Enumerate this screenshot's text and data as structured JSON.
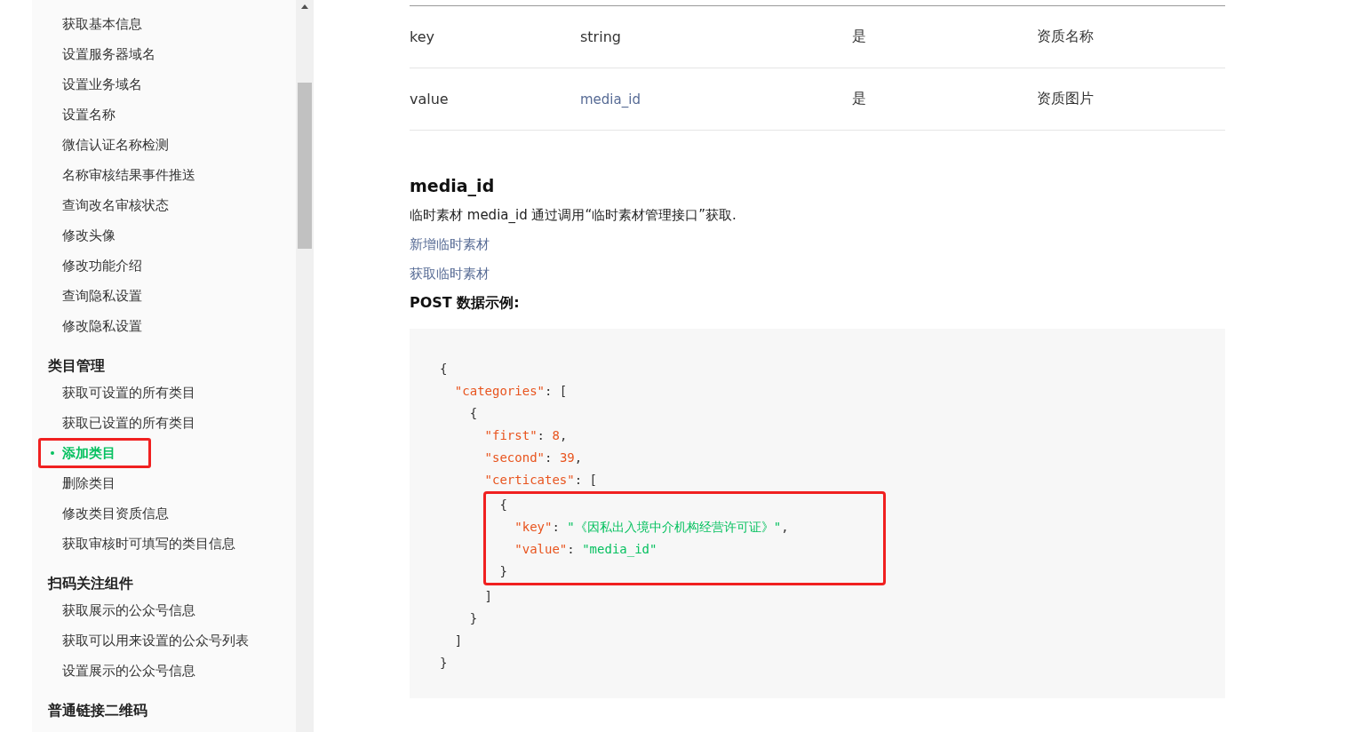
{
  "sidebar": {
    "groups": [
      {
        "items": [
          {
            "label": "获取基本信息",
            "selected": false,
            "highlighted": false
          },
          {
            "label": "设置服务器域名",
            "selected": false,
            "highlighted": false
          },
          {
            "label": "设置业务域名",
            "selected": false,
            "highlighted": false
          },
          {
            "label": "设置名称",
            "selected": false,
            "highlighted": false
          },
          {
            "label": "微信认证名称检测",
            "selected": false,
            "highlighted": false
          },
          {
            "label": "名称审核结果事件推送",
            "selected": false,
            "highlighted": false
          },
          {
            "label": "查询改名审核状态",
            "selected": false,
            "highlighted": false
          },
          {
            "label": "修改头像",
            "selected": false,
            "highlighted": false
          },
          {
            "label": "修改功能介绍",
            "selected": false,
            "highlighted": false
          },
          {
            "label": "查询隐私设置",
            "selected": false,
            "highlighted": false
          },
          {
            "label": "修改隐私设置",
            "selected": false,
            "highlighted": false
          }
        ]
      },
      {
        "title": "类目管理",
        "items": [
          {
            "label": "获取可设置的所有类目",
            "selected": false,
            "highlighted": false
          },
          {
            "label": "获取已设置的所有类目",
            "selected": false,
            "highlighted": false
          },
          {
            "label": "添加类目",
            "selected": true,
            "highlighted": true
          },
          {
            "label": "删除类目",
            "selected": false,
            "highlighted": false
          },
          {
            "label": "修改类目资质信息",
            "selected": false,
            "highlighted": false
          },
          {
            "label": "获取审核时可填写的类目信息",
            "selected": false,
            "highlighted": false
          }
        ]
      },
      {
        "title": "扫码关注组件",
        "items": [
          {
            "label": "获取展示的公众号信息",
            "selected": false,
            "highlighted": false
          },
          {
            "label": "获取可以用来设置的公众号列表",
            "selected": false,
            "highlighted": false
          },
          {
            "label": "设置展示的公众号信息",
            "selected": false,
            "highlighted": false
          }
        ]
      },
      {
        "title": "普通链接二维码"
      }
    ]
  },
  "table": {
    "rows": [
      [
        {
          "text": "key",
          "kind": "plain"
        },
        {
          "text": "string",
          "kind": "plain"
        },
        {
          "text": "是",
          "kind": "plain"
        },
        {
          "text": "资质名称",
          "kind": "plain"
        }
      ],
      [
        {
          "text": "value",
          "kind": "plain"
        },
        {
          "text": "media_id",
          "kind": "link"
        },
        {
          "text": "是",
          "kind": "plain"
        },
        {
          "text": "资质图片",
          "kind": "plain"
        }
      ]
    ]
  },
  "section": {
    "heading": "media_id",
    "paragraph": "临时素材 media_id 通过调用“临时素材管理接口”获取.",
    "links": [
      "新增临时素材",
      "获取临时素材"
    ],
    "example_label": "POST 数据示例:"
  },
  "code": {
    "sections": [
      {
        "highlighted": false,
        "lines": [
          [
            {
              "kind": "punct",
              "text": "{"
            }
          ],
          [
            {
              "kind": "key",
              "text": "  \"categories\""
            },
            {
              "kind": "punct",
              "text": ": ["
            }
          ],
          [
            {
              "kind": "punct",
              "text": "    {"
            }
          ],
          [
            {
              "kind": "key",
              "text": "      \"first\""
            },
            {
              "kind": "punct",
              "text": ": "
            },
            {
              "kind": "number",
              "text": "8"
            },
            {
              "kind": "punct",
              "text": ","
            }
          ],
          [
            {
              "kind": "key",
              "text": "      \"second\""
            },
            {
              "kind": "punct",
              "text": ": "
            },
            {
              "kind": "number",
              "text": "39"
            },
            {
              "kind": "punct",
              "text": ","
            }
          ],
          [
            {
              "kind": "key",
              "text": "      \"certicates\""
            },
            {
              "kind": "punct",
              "text": ": ["
            }
          ]
        ]
      },
      {
        "highlighted": true,
        "lines": [
          [
            {
              "kind": "punct",
              "text": "        {"
            }
          ],
          [
            {
              "kind": "key",
              "text": "          \"key\""
            },
            {
              "kind": "punct",
              "text": ": "
            },
            {
              "kind": "string",
              "text": "\"《因私出入境中介机构经营许可证》\""
            },
            {
              "kind": "punct",
              "text": ","
            }
          ],
          [
            {
              "kind": "key",
              "text": "          \"value\""
            },
            {
              "kind": "punct",
              "text": ": "
            },
            {
              "kind": "string",
              "text": "\"media_id\""
            }
          ],
          [
            {
              "kind": "punct",
              "text": "        }"
            }
          ]
        ]
      },
      {
        "highlighted": false,
        "lines": [
          [
            {
              "kind": "punct",
              "text": "      ]"
            }
          ],
          [
            {
              "kind": "punct",
              "text": "    }"
            }
          ],
          [
            {
              "kind": "punct",
              "text": "  ]"
            }
          ],
          [
            {
              "kind": "punct",
              "text": "}"
            }
          ]
        ]
      }
    ]
  }
}
